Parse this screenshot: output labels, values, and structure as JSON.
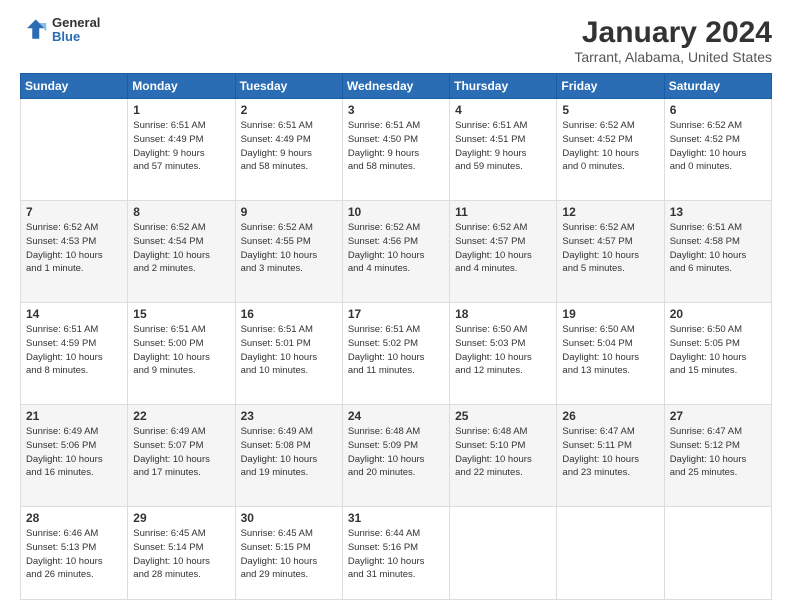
{
  "logo": {
    "line1": "General",
    "line2": "Blue"
  },
  "title": "January 2024",
  "subtitle": "Tarrant, Alabama, United States",
  "days_of_week": [
    "Sunday",
    "Monday",
    "Tuesday",
    "Wednesday",
    "Thursday",
    "Friday",
    "Saturday"
  ],
  "weeks": [
    [
      {
        "day": "",
        "info": ""
      },
      {
        "day": "1",
        "info": "Sunrise: 6:51 AM\nSunset: 4:49 PM\nDaylight: 9 hours\nand 57 minutes."
      },
      {
        "day": "2",
        "info": "Sunrise: 6:51 AM\nSunset: 4:49 PM\nDaylight: 9 hours\nand 58 minutes."
      },
      {
        "day": "3",
        "info": "Sunrise: 6:51 AM\nSunset: 4:50 PM\nDaylight: 9 hours\nand 58 minutes."
      },
      {
        "day": "4",
        "info": "Sunrise: 6:51 AM\nSunset: 4:51 PM\nDaylight: 9 hours\nand 59 minutes."
      },
      {
        "day": "5",
        "info": "Sunrise: 6:52 AM\nSunset: 4:52 PM\nDaylight: 10 hours\nand 0 minutes."
      },
      {
        "day": "6",
        "info": "Sunrise: 6:52 AM\nSunset: 4:52 PM\nDaylight: 10 hours\nand 0 minutes."
      }
    ],
    [
      {
        "day": "7",
        "info": "Sunrise: 6:52 AM\nSunset: 4:53 PM\nDaylight: 10 hours\nand 1 minute."
      },
      {
        "day": "8",
        "info": "Sunrise: 6:52 AM\nSunset: 4:54 PM\nDaylight: 10 hours\nand 2 minutes."
      },
      {
        "day": "9",
        "info": "Sunrise: 6:52 AM\nSunset: 4:55 PM\nDaylight: 10 hours\nand 3 minutes."
      },
      {
        "day": "10",
        "info": "Sunrise: 6:52 AM\nSunset: 4:56 PM\nDaylight: 10 hours\nand 4 minutes."
      },
      {
        "day": "11",
        "info": "Sunrise: 6:52 AM\nSunset: 4:57 PM\nDaylight: 10 hours\nand 4 minutes."
      },
      {
        "day": "12",
        "info": "Sunrise: 6:52 AM\nSunset: 4:57 PM\nDaylight: 10 hours\nand 5 minutes."
      },
      {
        "day": "13",
        "info": "Sunrise: 6:51 AM\nSunset: 4:58 PM\nDaylight: 10 hours\nand 6 minutes."
      }
    ],
    [
      {
        "day": "14",
        "info": "Sunrise: 6:51 AM\nSunset: 4:59 PM\nDaylight: 10 hours\nand 8 minutes."
      },
      {
        "day": "15",
        "info": "Sunrise: 6:51 AM\nSunset: 5:00 PM\nDaylight: 10 hours\nand 9 minutes."
      },
      {
        "day": "16",
        "info": "Sunrise: 6:51 AM\nSunset: 5:01 PM\nDaylight: 10 hours\nand 10 minutes."
      },
      {
        "day": "17",
        "info": "Sunrise: 6:51 AM\nSunset: 5:02 PM\nDaylight: 10 hours\nand 11 minutes."
      },
      {
        "day": "18",
        "info": "Sunrise: 6:50 AM\nSunset: 5:03 PM\nDaylight: 10 hours\nand 12 minutes."
      },
      {
        "day": "19",
        "info": "Sunrise: 6:50 AM\nSunset: 5:04 PM\nDaylight: 10 hours\nand 13 minutes."
      },
      {
        "day": "20",
        "info": "Sunrise: 6:50 AM\nSunset: 5:05 PM\nDaylight: 10 hours\nand 15 minutes."
      }
    ],
    [
      {
        "day": "21",
        "info": "Sunrise: 6:49 AM\nSunset: 5:06 PM\nDaylight: 10 hours\nand 16 minutes."
      },
      {
        "day": "22",
        "info": "Sunrise: 6:49 AM\nSunset: 5:07 PM\nDaylight: 10 hours\nand 17 minutes."
      },
      {
        "day": "23",
        "info": "Sunrise: 6:49 AM\nSunset: 5:08 PM\nDaylight: 10 hours\nand 19 minutes."
      },
      {
        "day": "24",
        "info": "Sunrise: 6:48 AM\nSunset: 5:09 PM\nDaylight: 10 hours\nand 20 minutes."
      },
      {
        "day": "25",
        "info": "Sunrise: 6:48 AM\nSunset: 5:10 PM\nDaylight: 10 hours\nand 22 minutes."
      },
      {
        "day": "26",
        "info": "Sunrise: 6:47 AM\nSunset: 5:11 PM\nDaylight: 10 hours\nand 23 minutes."
      },
      {
        "day": "27",
        "info": "Sunrise: 6:47 AM\nSunset: 5:12 PM\nDaylight: 10 hours\nand 25 minutes."
      }
    ],
    [
      {
        "day": "28",
        "info": "Sunrise: 6:46 AM\nSunset: 5:13 PM\nDaylight: 10 hours\nand 26 minutes."
      },
      {
        "day": "29",
        "info": "Sunrise: 6:45 AM\nSunset: 5:14 PM\nDaylight: 10 hours\nand 28 minutes."
      },
      {
        "day": "30",
        "info": "Sunrise: 6:45 AM\nSunset: 5:15 PM\nDaylight: 10 hours\nand 29 minutes."
      },
      {
        "day": "31",
        "info": "Sunrise: 6:44 AM\nSunset: 5:16 PM\nDaylight: 10 hours\nand 31 minutes."
      },
      {
        "day": "",
        "info": ""
      },
      {
        "day": "",
        "info": ""
      },
      {
        "day": "",
        "info": ""
      }
    ]
  ]
}
